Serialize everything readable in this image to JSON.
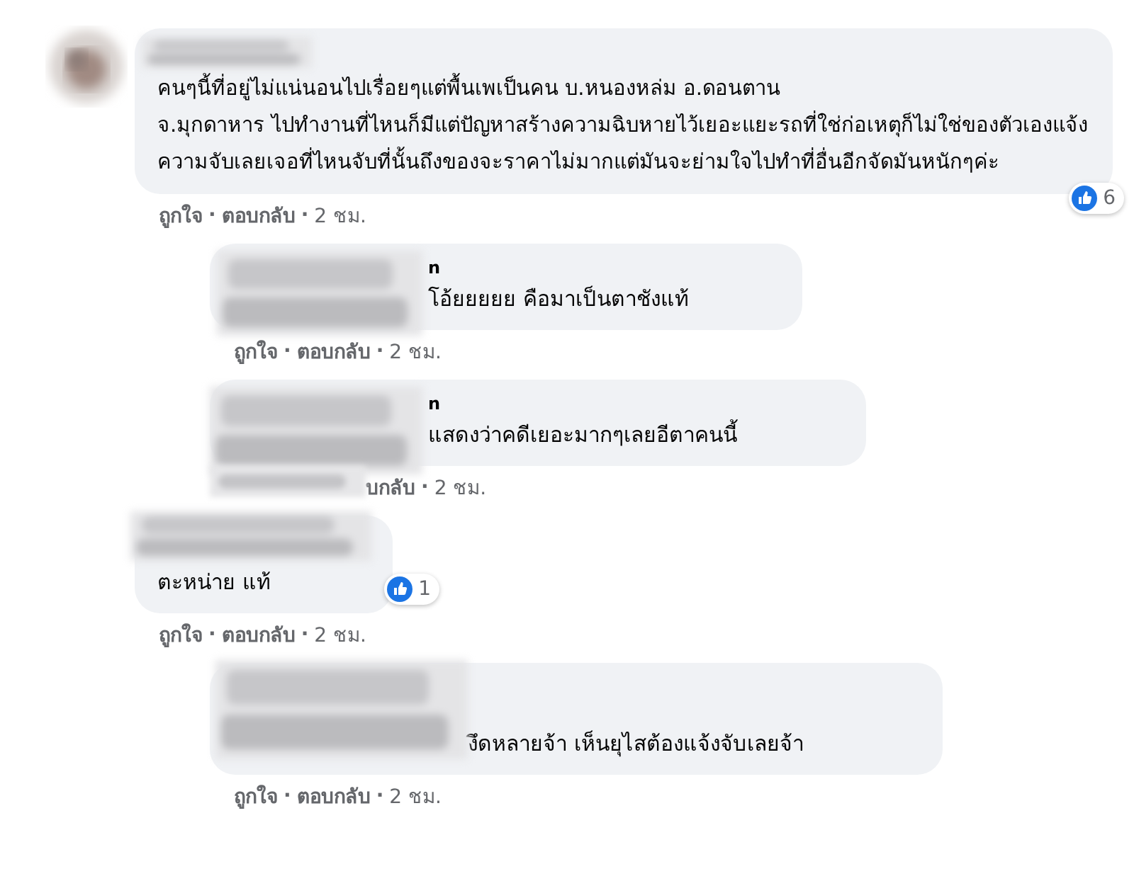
{
  "comments": [
    {
      "kind": "comment",
      "text": "คนๆนี้ที่อยู่ไม่แน่นอนไปเรื่อยๆแต่พื้นเพเป็นคน บ.หนองหล่ม อ.ดอนตาน\nจ.มุกดาหาร ไปทำงานที่ไหนก็มีแต่ปัญหาสร้างความฉิบหายไว้เยอะแยะรถที่ใช่ก่อเหตุก็ไม่ใช่ของตัวเองแจ้งความจับเลยเจอที่ไหนจับที่นั้นถึงของจะราคาไม่มากแต่มันจะย่ามใจไปทำที่อื่นอีกจัดมันหนักๆค่ะ",
      "reactions": "6",
      "actions": [
        {
          "kind": "link",
          "text": "ถูกใจ"
        },
        {
          "kind": "dot",
          "text": "·"
        },
        {
          "kind": "link",
          "text": "ตอบกลับ"
        },
        {
          "kind": "dot",
          "text": "·"
        },
        {
          "kind": "time",
          "text": "2 ชม."
        }
      ]
    },
    {
      "kind": "reply",
      "name": "n",
      "text": "โอ้ยยยยย คือมาเป็นตาชังแท้",
      "actions": [
        {
          "kind": "link",
          "text": "ถูกใจ"
        },
        {
          "kind": "dot",
          "text": "·"
        },
        {
          "kind": "link",
          "text": "ตอบกลับ"
        },
        {
          "kind": "dot",
          "text": "·"
        },
        {
          "kind": "time",
          "text": "2 ชม."
        }
      ]
    },
    {
      "kind": "reply",
      "name": "n",
      "text": "แสดงว่าคดีเยอะมากๆเลยอีตาคนนี้",
      "actions": [
        {
          "kind": "link",
          "text": "บกลับ"
        },
        {
          "kind": "dot",
          "text": "·"
        },
        {
          "kind": "time",
          "text": "2 ชม."
        }
      ]
    },
    {
      "kind": "comment",
      "text": "ตะหน่าย แท้",
      "reactions": "1",
      "actions": [
        {
          "kind": "link",
          "text": "ถูกใจ"
        },
        {
          "kind": "dot",
          "text": "·"
        },
        {
          "kind": "link",
          "text": "ตอบกลับ"
        },
        {
          "kind": "dot",
          "text": "·"
        },
        {
          "kind": "time",
          "text": "2 ชม."
        }
      ]
    },
    {
      "kind": "reply",
      "text": "งึดหลายจ้า เห็นยุไสต้องแจ้งจับเลยจ้า",
      "actions": [
        {
          "kind": "link",
          "text": "ถูกใจ"
        },
        {
          "kind": "dot",
          "text": "·"
        },
        {
          "kind": "link",
          "text": "ตอบกลับ"
        },
        {
          "kind": "dot",
          "text": "·"
        },
        {
          "kind": "time",
          "text": "2 ชม."
        }
      ]
    }
  ]
}
